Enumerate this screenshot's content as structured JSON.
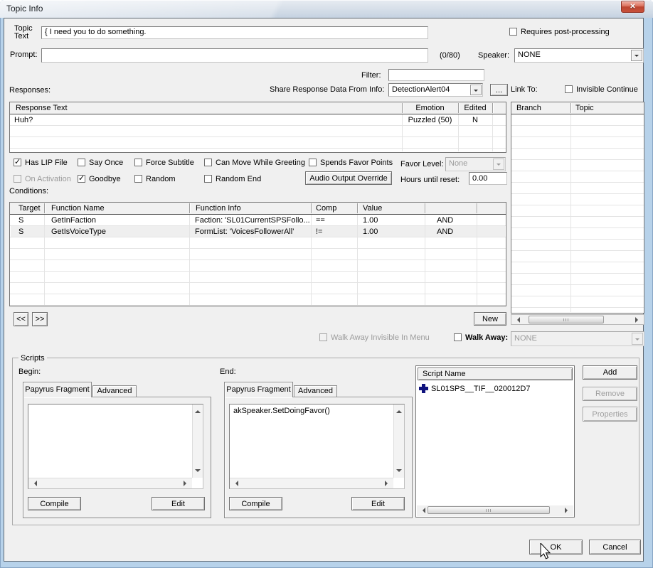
{
  "window": {
    "title": "Topic Info"
  },
  "icons": {
    "close": "✕",
    "check": "✓"
  },
  "topic_text": {
    "label_line1": "Topic",
    "label_line2": "Text",
    "value": "{ I need you to do something."
  },
  "requires_post_processing": {
    "label": "Requires post-processing",
    "checked": false
  },
  "prompt": {
    "label": "Prompt:",
    "value": "",
    "counter": "(0/80)"
  },
  "speaker": {
    "label": "Speaker:",
    "value": "NONE"
  },
  "filter": {
    "label": "Filter:",
    "value": ""
  },
  "share_response": {
    "label": "Share Response Data From Info:",
    "value": "DetectionAlert04",
    "more_button": "..."
  },
  "responses": {
    "label": "Responses:",
    "columns": [
      "Response Text",
      "Emotion",
      "Edited"
    ],
    "rows": [
      {
        "response_text": "Huh?",
        "emotion": "Puzzled (50)",
        "edited": "N"
      }
    ]
  },
  "link_to": {
    "label": "Link To:",
    "invisible_continue": {
      "label": "Invisible Continue",
      "checked": false
    },
    "columns": [
      "Branch",
      "Topic"
    ],
    "rows": []
  },
  "flags": {
    "has_lip_file": {
      "label": "Has LIP File",
      "checked": true
    },
    "say_once": {
      "label": "Say Once",
      "checked": false
    },
    "force_subtitle": {
      "label": "Force Subtitle",
      "checked": false
    },
    "can_move_while_greeting": {
      "label": "Can Move While Greeting",
      "checked": false
    },
    "spends_favor_points": {
      "label": "Spends Favor Points",
      "checked": false
    },
    "on_activation": {
      "label": "On Activation",
      "checked": false,
      "disabled": true
    },
    "goodbye": {
      "label": "Goodbye",
      "checked": true
    },
    "random": {
      "label": "Random",
      "checked": false
    },
    "random_end": {
      "label": "Random End",
      "checked": false
    }
  },
  "favor_level": {
    "label": "Favor Level:",
    "value": "None",
    "disabled": true
  },
  "audio_output_override": {
    "label": "Audio Output Override"
  },
  "hours_until_reset": {
    "label": "Hours until reset:",
    "value": "0.00"
  },
  "conditions": {
    "label": "Conditions:",
    "columns": [
      "Target",
      "Function Name",
      "Function Info",
      "Comp",
      "Value"
    ],
    "rows": [
      {
        "target": "S",
        "function_name": "GetInFaction",
        "function_info": "Faction: 'SL01CurrentSPSFollo...",
        "comp": "==",
        "value": "1.00",
        "operator": "AND"
      },
      {
        "target": "S",
        "function_name": "GetIsVoiceType",
        "function_info": "FormList: 'VoicesFollowerAll'",
        "comp": "!=",
        "value": "1.00",
        "operator": "AND"
      }
    ],
    "prev_button": "<<",
    "next_button": ">>",
    "new_button": "New"
  },
  "walk_away": {
    "invisible_label": "Walk Away Invisible In Menu",
    "label": "Walk Away:",
    "value": "NONE"
  },
  "scripts": {
    "group_label": "Scripts",
    "begin": {
      "label": "Begin:",
      "tab1": "Papyrus Fragment",
      "tab2": "Advanced",
      "fragment": "",
      "compile": "Compile",
      "edit": "Edit"
    },
    "end": {
      "label": "End:",
      "tab1": "Papyrus Fragment",
      "tab2": "Advanced",
      "fragment": "akSpeaker.SetDoingFavor()",
      "compile": "Compile",
      "edit": "Edit"
    },
    "list": {
      "header": "Script Name",
      "items": [
        {
          "name": "SL01SPS__TIF__020012D7"
        }
      ]
    },
    "add": "Add",
    "remove": "Remove",
    "properties": "Properties"
  },
  "footer": {
    "ok": "OK",
    "cancel": "Cancel"
  }
}
